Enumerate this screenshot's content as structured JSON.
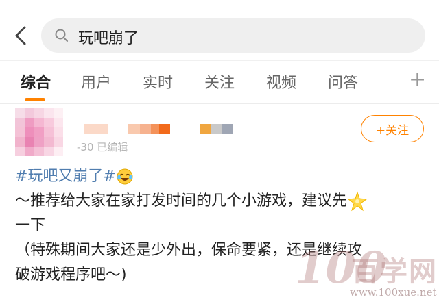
{
  "search": {
    "query": "玩吧崩了"
  },
  "tabs": [
    {
      "label": "综合"
    },
    {
      "label": "用户"
    },
    {
      "label": "实时"
    },
    {
      "label": "关注"
    },
    {
      "label": "视频"
    },
    {
      "label": "问答"
    }
  ],
  "post": {
    "meta": "-30  已编辑",
    "follow_label": "+关注",
    "hashtag": "#玩吧又崩了#",
    "line1": "～推荐给大家在家打发时间的几个小游戏，建议先",
    "line2": "一下",
    "line3": "（特殊期间大家还是少外出，保命要紧，还是继续攻",
    "line4": "破游戏程序吧～)"
  },
  "watermark": {
    "mark": "100",
    "text": "百学网",
    "url": "www.100xue.net"
  },
  "colors": {
    "accent": "#ff8200",
    "link": "#507daf",
    "search_bg": "#efefef"
  }
}
